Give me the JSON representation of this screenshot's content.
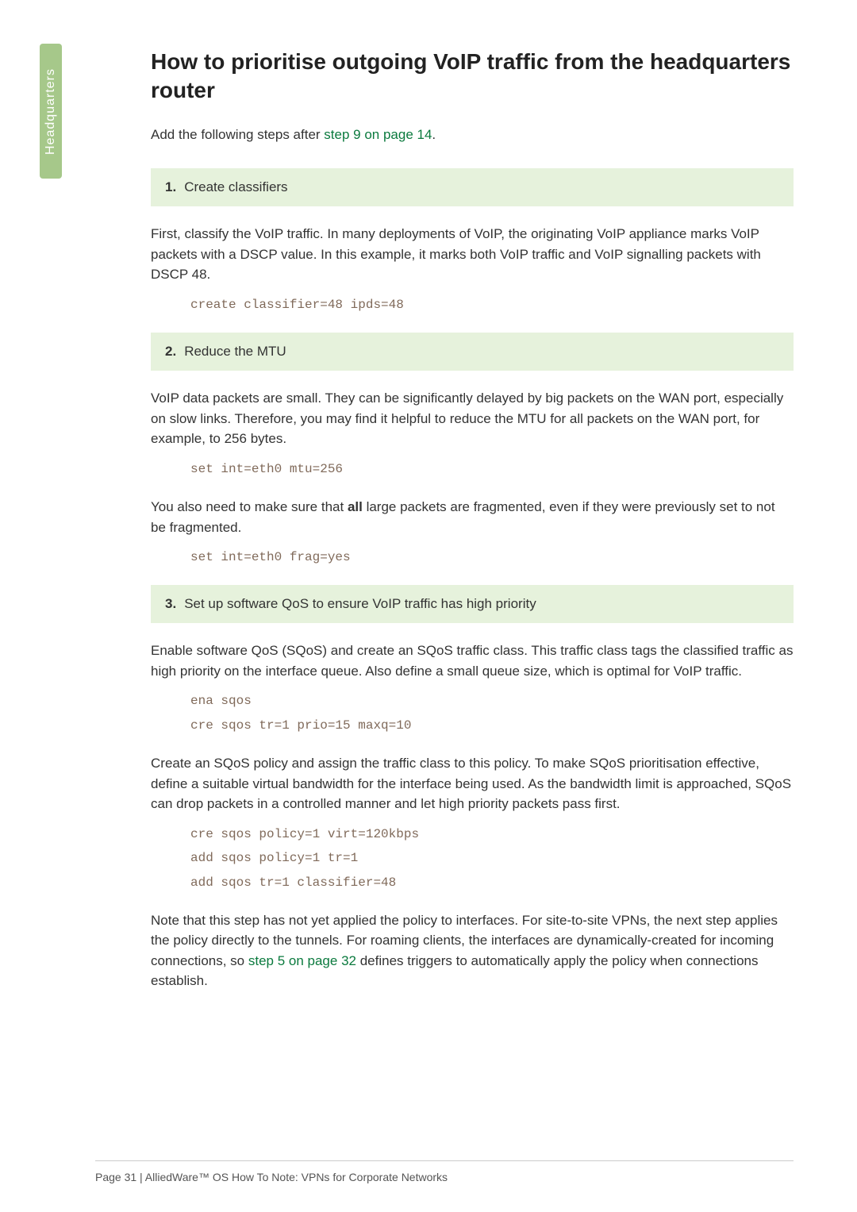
{
  "sidebar": {
    "label": "Headquarters"
  },
  "title": "How to prioritise outgoing VoIP traffic from the headquarters router",
  "intro_pre": "Add the following steps after ",
  "intro_link": "step 9 on page 14",
  "intro_post": ".",
  "step1": {
    "num": "1.",
    "label": "Create classifiers",
    "para": "First, classify the VoIP traffic. In many deployments of VoIP, the originating VoIP appliance marks VoIP packets with a DSCP value. In this example, it marks both VoIP traffic and VoIP signalling packets with DSCP 48.",
    "code": "create classifier=48 ipds=48"
  },
  "step2": {
    "num": "2.",
    "label": "Reduce the MTU",
    "para1": "VoIP data packets are small. They can be significantly delayed by big packets on the WAN port, especially on slow links. Therefore, you may find it helpful to reduce the MTU for all packets on the WAN port, for example, to 256 bytes.",
    "code1": "set int=eth0 mtu=256",
    "para2_pre": "You also need to make sure that ",
    "para2_bold": "all",
    "para2_post": " large packets are fragmented, even if they were previously set to not be fragmented.",
    "code2": "set int=eth0 frag=yes"
  },
  "step3": {
    "num": "3.",
    "label": "Set up software QoS to ensure VoIP traffic has high priority",
    "para1": "Enable software QoS (SQoS) and create an SQoS traffic class. This traffic class tags the classified traffic as high priority on the interface queue. Also define a small queue size, which is optimal for VoIP traffic.",
    "code1": "ena sqos\ncre sqos tr=1 prio=15 maxq=10",
    "para2": "Create an SQoS policy and assign the traffic class to this policy. To make SQoS prioritisation effective, define a suitable virtual bandwidth for the interface being used.  As the bandwidth limit is approached, SQoS can drop packets in a controlled manner and let high priority packets pass first.",
    "code2": "cre sqos policy=1 virt=120kbps\nadd sqos policy=1 tr=1\nadd sqos tr=1 classifier=48",
    "para3_pre": "Note that this step has not yet applied the policy to interfaces. For site-to-site VPNs, the next step applies the policy directly to the tunnels. For roaming clients, the interfaces are dynamically-created for incoming connections, so ",
    "para3_link": "step 5 on page 32",
    "para3_post": " defines triggers to automatically apply the policy when connections establish."
  },
  "footer": "Page 31 | AlliedWare™ OS How To Note: VPNs for Corporate Networks"
}
